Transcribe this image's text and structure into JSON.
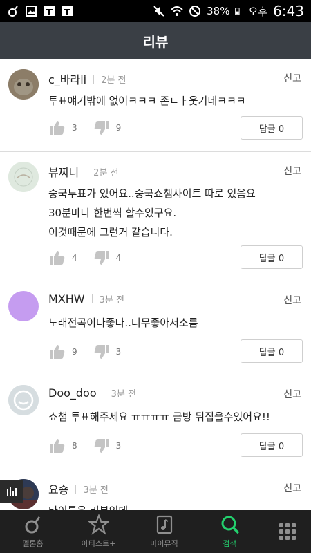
{
  "status_bar": {
    "battery": "38%",
    "ampm": "오후",
    "time": "6:43"
  },
  "header": {
    "title": "리뷰"
  },
  "reviews": [
    {
      "user": "c_바라ii",
      "time": "2분 전",
      "report": "신고",
      "lines": [
        "투표얘기밖에 없어ㅋㅋㅋ 존ㄴㅏ웃기네ㅋㅋㅋ"
      ],
      "likes": "3",
      "dislikes": "9",
      "reply": "답글 0",
      "avatar_color": "#7a6a55"
    },
    {
      "user": "뷰찌니",
      "time": "2분 전",
      "report": "신고",
      "lines": [
        "중국투표가 있어요..중국쇼챔사이트 따로 있음요",
        "30분마다 한번씩 할수있구요.",
        "이것때문에 그런거 같습니다."
      ],
      "likes": "4",
      "dislikes": "4",
      "reply": "답글 0",
      "avatar_color": "#d9e6d9"
    },
    {
      "user": "MXHW",
      "time": "3분 전",
      "report": "신고",
      "lines": [
        "노래전곡이다좋다..너무좋아서소름"
      ],
      "likes": "9",
      "dislikes": "3",
      "reply": "답글 0",
      "avatar_color": "#c59cf0"
    },
    {
      "user": "Doo_doo",
      "time": "3분 전",
      "report": "신고",
      "lines": [
        "쇼챔 투표해주세요 ㅠㅠㅠㅠ 금방 뒤집을수있어요!!"
      ],
      "likes": "8",
      "dislikes": "3",
      "reply": "답글 0",
      "avatar_color": "#d6dde0"
    },
    {
      "user": "요숑",
      "time": "3분 전",
      "report": "신고",
      "lines": [
        "타이틀은 리부인데"
      ],
      "avatar_color": "#3b4a66"
    }
  ],
  "nav": [
    {
      "label": "멜론홈",
      "icon": "melon-icon"
    },
    {
      "label": "아티스트+",
      "icon": "star-icon"
    },
    {
      "label": "마이뮤직",
      "icon": "music-note-icon"
    },
    {
      "label": "검색",
      "icon": "search-icon",
      "active": true
    }
  ],
  "colors": {
    "header": "#3a3f45",
    "accent": "#23d16e",
    "navbar": "#1f1f1f"
  }
}
